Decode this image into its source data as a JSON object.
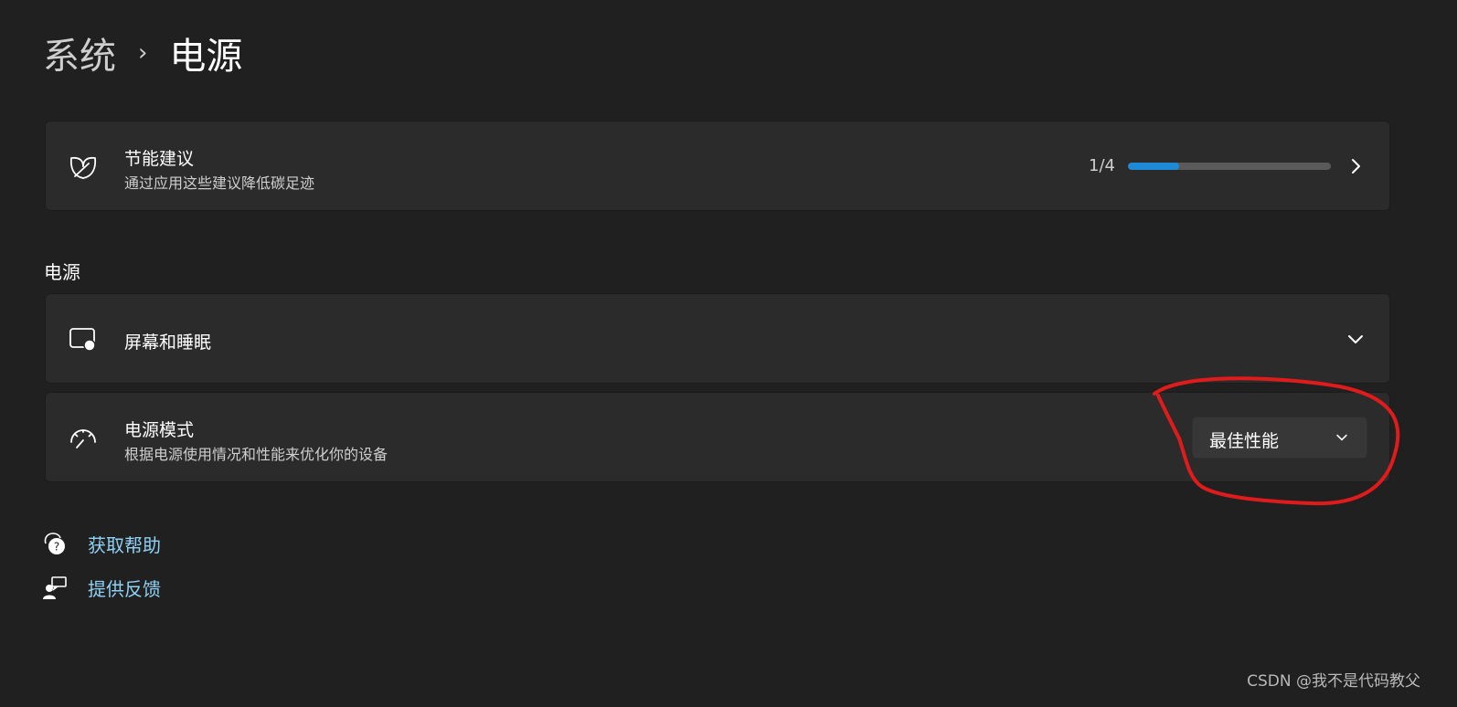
{
  "breadcrumb": {
    "parent": "系统",
    "separator": "›",
    "current": "电源"
  },
  "energy_card": {
    "icon": "leaf-icon",
    "title": "节能建议",
    "subtitle": "通过应用这些建议降低碳足迹",
    "progress_text": "1/4",
    "progress_fraction": 0.25
  },
  "power_section": {
    "heading": "电源",
    "screen_sleep": {
      "icon": "screen-sleep-icon",
      "title": "屏幕和睡眠"
    },
    "power_mode": {
      "icon": "speedometer-icon",
      "title": "电源模式",
      "subtitle": "根据电源使用情况和性能来优化你的设备",
      "selected": "最佳性能"
    }
  },
  "links": {
    "help": "获取帮助",
    "feedback": "提供反馈"
  },
  "watermark": "CSDN @我不是代码教父",
  "colors": {
    "accent": "#1e8ad6",
    "link": "#8ed1f3",
    "annotation": "#e01b1b"
  }
}
